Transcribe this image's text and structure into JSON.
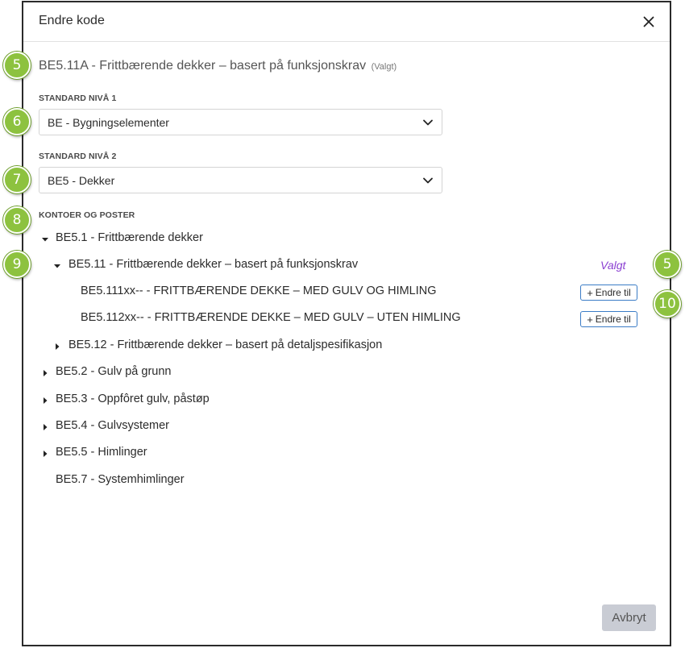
{
  "dialog": {
    "title": "Endre kode",
    "selected": {
      "code": "BE5.11A - Frittbærende dekker – basert på funksjonskrav",
      "suffix": "(Valgt)"
    },
    "level1": {
      "label": "STANDARD NIVÅ 1",
      "value": "BE - Bygningselementer"
    },
    "level2": {
      "label": "STANDARD NIVÅ 2",
      "value": "BE5 - Dekker"
    },
    "accounts_label": "KONTOER OG POSTER",
    "tree": [
      {
        "label": "BE5.1 - Frittbærende dekker"
      },
      {
        "label": "BE5.11 - Frittbærende dekker – basert på funksjonskrav",
        "tag": "Valgt"
      },
      {
        "label": "BE5.111xx-- - FRITTBÆRENDE DEKKE – MED GULV OG HIMLING",
        "action": "Endre til"
      },
      {
        "label": "BE5.112xx-- - FRITTBÆRENDE DEKKE – MED GULV – UTEN HIMLING",
        "action": "Endre til"
      },
      {
        "label": "BE5.12 - Frittbærende dekker – basert på detaljspesifikasjon"
      },
      {
        "label": "BE5.2 - Gulv på grunn"
      },
      {
        "label": "BE5.3 - Oppfôret gulv, påstøp"
      },
      {
        "label": "BE5.4 - Gulvsystemer"
      },
      {
        "label": "BE5.5 - Himlinger"
      },
      {
        "label": "BE5.7 - Systemhimlinger"
      }
    ],
    "cancel_label": "Avbryt"
  },
  "badges": [
    "5",
    "6",
    "7",
    "8",
    "9",
    "5",
    "10"
  ],
  "colors": {
    "badge": "#8dc23f",
    "valgt": "#8a3fd1",
    "button_border": "#3b7cc6",
    "cancel_bg": "#c9ccd4"
  },
  "icons": {
    "close": "close-icon",
    "chevron": "chevron-down-icon",
    "expanded": "caret-down-icon",
    "collapsed": "caret-right-icon",
    "plus": "plus-icon"
  }
}
